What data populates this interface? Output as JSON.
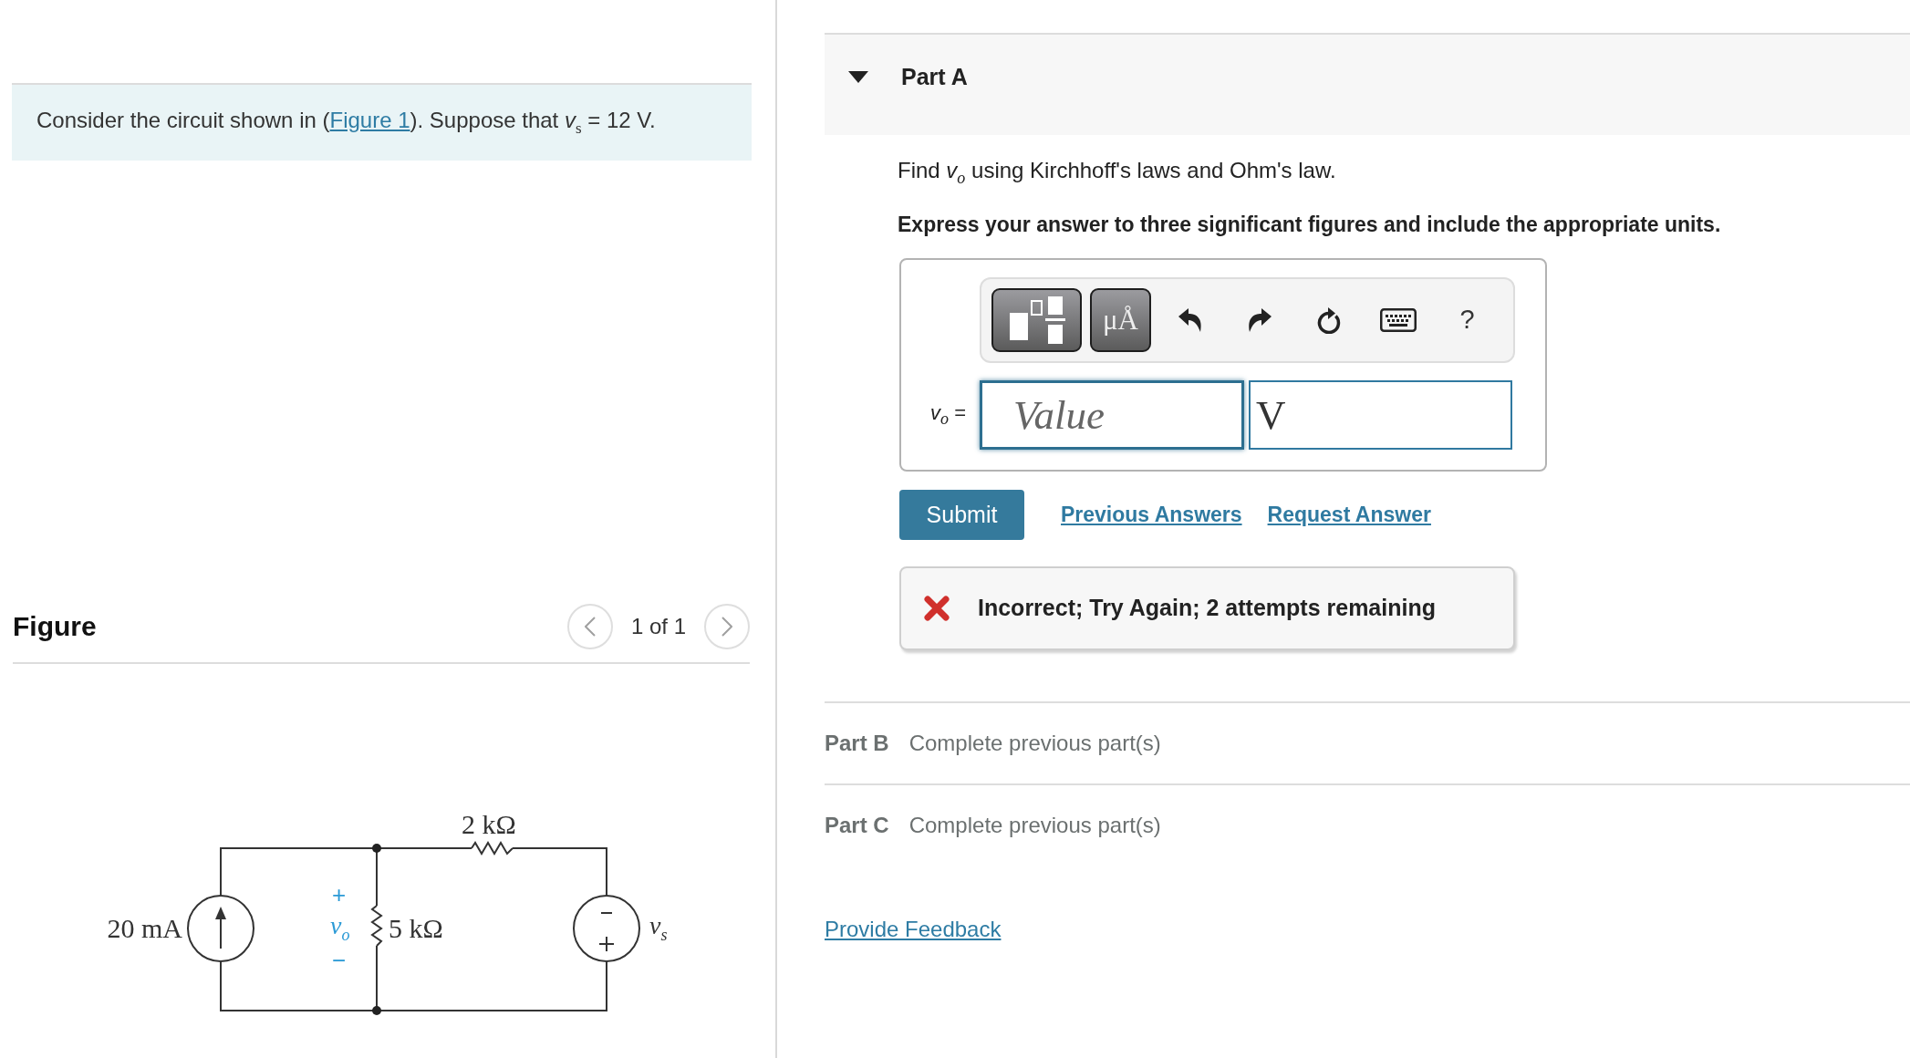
{
  "problem": {
    "text_before": "Consider the circuit shown in (",
    "link": "Figure 1",
    "text_after": "). Suppose that *v*$_{s}$ = 12 V."
  },
  "figure": {
    "title": "Figure",
    "pager": "1 of 1",
    "circuit": {
      "source_current": "20 mA",
      "resistor_top": "2 kΩ",
      "vo_plus": "+",
      "vo_label": "v$_{o}$",
      "vo_minus": "−",
      "resistor_middle": "5 kΩ",
      "source_voltage": "v$_{s}$"
    }
  },
  "parts": [
    {
      "kind": "open",
      "label": "Part A",
      "expanded": true,
      "question": "Find *v*$_{o}$ using Kirchhoff's laws and Ohm's law.",
      "instruction": "Express your answer to three significant figures and include the appropriate units.",
      "answer": {
        "toolbar": {
          "units_button": "μÅ",
          "help_button": "?"
        },
        "label": "*v*$_{o}$ =",
        "value": {
          "placeholder": "Value"
        },
        "units": {
          "value": "V"
        }
      },
      "actions": {
        "submit": "Submit",
        "links": [
          "Previous Answers",
          "Request Answer"
        ]
      },
      "feedback": {
        "kind": "incorrect",
        "message": "Incorrect; Try Again; 2 attempts remaining"
      }
    },
    {
      "kind": "locked",
      "label": "Part B",
      "status": "Complete previous part(s)"
    },
    {
      "kind": "locked",
      "label": "Part C",
      "status": "Complete previous part(s)"
    }
  ],
  "footer": {
    "link": "Provide Feedback"
  }
}
